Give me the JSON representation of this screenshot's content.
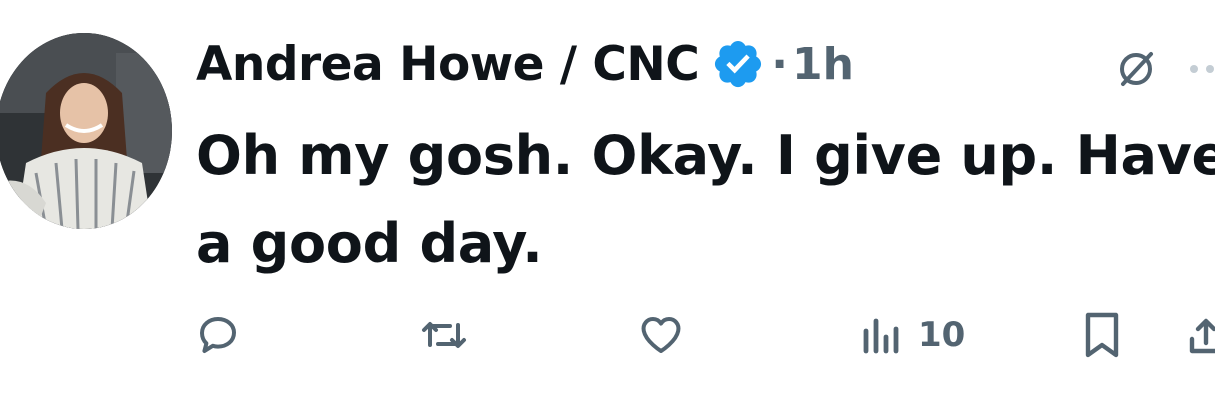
{
  "tweet": {
    "author_name": "Andrea Howe / CNC",
    "separator": "·",
    "timestamp": "1h",
    "text": "Oh my gosh. Okay. I give up. Have a good day.",
    "views_count": "10"
  },
  "colors": {
    "text": "#0f1419",
    "secondary": "#536471",
    "verified": "#1d9bf0",
    "background": "#ffffff"
  },
  "icons": {
    "verified": "verified-badge-icon",
    "grok": "grok-icon",
    "more": "more-icon",
    "reply": "reply-icon",
    "retweet": "retweet-icon",
    "like": "like-icon",
    "views": "views-icon",
    "bookmark": "bookmark-icon",
    "share": "share-icon"
  }
}
